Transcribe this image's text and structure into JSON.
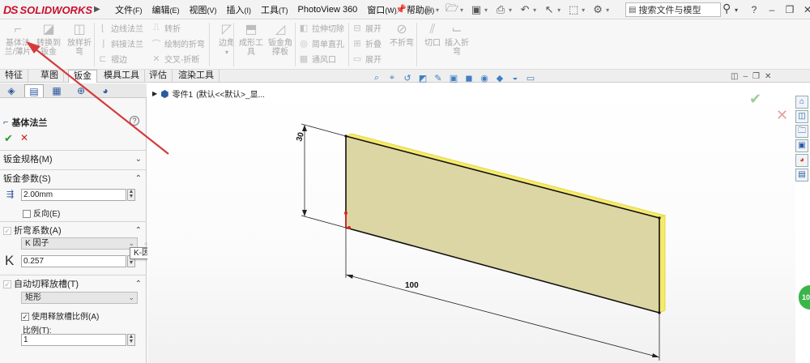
{
  "app": {
    "logo_text": "SOLIDWORKS",
    "logo_mark": "DS",
    "colors": {
      "brand": "#c8102e",
      "accent": "#2a64c8",
      "part_fill": "#dcd6a4",
      "part_edge": "#f5ea6a",
      "ok": "#2e9a2e",
      "cancel": "#d02020"
    }
  },
  "menu": [
    {
      "label": "文件",
      "key": "(F)"
    },
    {
      "label": "编辑",
      "key": "(E)"
    },
    {
      "label": "视图",
      "key": "(V)"
    },
    {
      "label": "插入",
      "key": "(I)"
    },
    {
      "label": "工具",
      "key": "(T)"
    },
    {
      "label": "PhotoView 360",
      "key": ""
    },
    {
      "label": "窗口",
      "key": "(W)"
    },
    {
      "label": "帮助",
      "key": "(H)"
    }
  ],
  "search": {
    "placeholder": "搜索文件与模型"
  },
  "commands": {
    "base_flange": "基体法兰/薄片",
    "convert_to_sheet": "转换到钣金",
    "lofted_bend": "放样折弯",
    "edge_flange": "边线法兰",
    "miter_flange": "斜接法兰",
    "hem": "褶边",
    "jog": "转折",
    "sketched_bend": "绘制的折弯",
    "cross_break": "交叉-折断",
    "corners": "边角",
    "forming_tool": "成形工具",
    "sheet_metal_gusset": "钣金角撑板",
    "extruded_cut": "拉伸切除",
    "simple_hole": "简单直孔",
    "vent": "通风口",
    "unfold": "展开",
    "fold": "折叠",
    "flatten": "展开",
    "no_bends": "不折弯",
    "rip": "切口",
    "insert_bends": "插入折弯"
  },
  "tabs": [
    {
      "label": "特征"
    },
    {
      "label": "草图"
    },
    {
      "label": "钣金"
    },
    {
      "label": "模具工具"
    },
    {
      "label": "评估"
    },
    {
      "label": "渲染工具"
    }
  ],
  "property_manager": {
    "title": "基体法兰",
    "help": "?",
    "sections": {
      "gauge": {
        "title": "钣金规格(M)"
      },
      "params": {
        "title": "钣金参数(S)",
        "thickness": "2.00mm",
        "reverse_label": "反向(E)"
      },
      "bend_allowance": {
        "title": "折弯系数(A)",
        "type": "K 因子",
        "k_value": "0.257",
        "k_symbol": "K",
        "tooltip": "K-因子"
      },
      "auto_relief": {
        "title": "自动切释放槽(T)",
        "type": "矩形",
        "use_ratio_label": "使用释放槽比例(A)",
        "ratio_label": "比例(T):",
        "ratio_value": "1"
      }
    }
  },
  "tree": {
    "root": "零件1",
    "config": "(默认<<默认>_显..."
  },
  "dimensions": {
    "height": "30",
    "length": "100"
  }
}
